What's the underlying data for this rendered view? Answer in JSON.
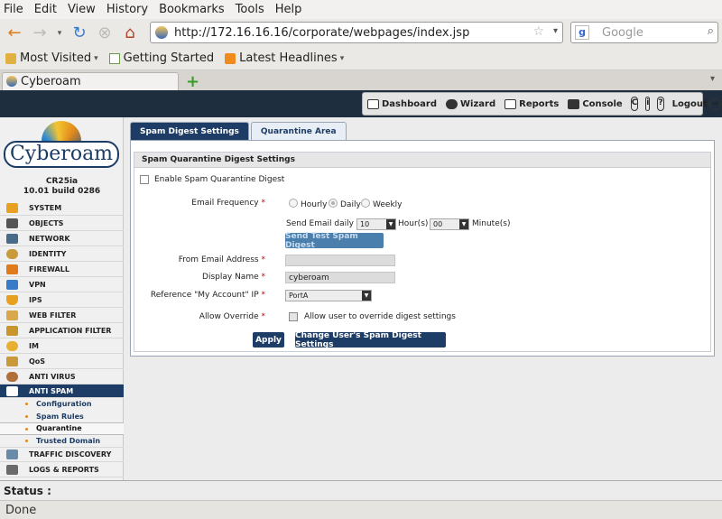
{
  "browser": {
    "menu": [
      "File",
      "Edit",
      "View",
      "History",
      "Bookmarks",
      "Tools",
      "Help"
    ],
    "url": "http://172.16.16.16/corporate/webpages/index.jsp",
    "search_placeholder": "Google",
    "bookmarks": [
      "Most Visited",
      "Getting Started",
      "Latest Headlines"
    ],
    "tab_title": "Cyberoam",
    "status_done": "Done"
  },
  "toolbar": {
    "dashboard": "Dashboard",
    "wizard": "Wizard",
    "reports": "Reports",
    "console": "Console",
    "logout": "Logout"
  },
  "brand": {
    "logo_text": "Cyberoam",
    "model": "CR25ia",
    "version": "10.01 build 0286"
  },
  "nav": {
    "items": [
      "SYSTEM",
      "OBJECTS",
      "NETWORK",
      "IDENTITY",
      "FIREWALL",
      "VPN",
      "IPS",
      "WEB FILTER",
      "APPLICATION FILTER",
      "IM",
      "QoS",
      "ANTI VIRUS"
    ],
    "active": "ANTI SPAM",
    "subitems": [
      "Configuration",
      "Spam Rules",
      "Quarantine",
      "Trusted Domain"
    ],
    "after": [
      "TRAFFIC DISCOVERY",
      "LOGS & REPORTS"
    ]
  },
  "tabs": [
    "Spam Digest Settings",
    "Quarantine Area"
  ],
  "form": {
    "section_title": "Spam Quarantine Digest Settings",
    "enable_label": "Enable Spam Quarantine Digest",
    "freq_label": "Email Frequency",
    "req": "*",
    "freq_options": [
      "Hourly",
      "Daily",
      "Weekly"
    ],
    "send_daily_label": "Send Email daily at",
    "hour_value": "10",
    "hours_label": "Hour(s)",
    "minute_value": "00",
    "minutes_label": "Minute(s)",
    "send_test_button": "Send Test Spam Digest",
    "from_label": "From Email Address",
    "from_value": "",
    "display_label": "Display Name",
    "display_value": "cyberoam",
    "ref_label": "Reference \"My Account\" IP",
    "ref_value": "PortA",
    "override_label": "Allow Override",
    "override_checkbox": "Allow user to override digest settings",
    "apply_button": "Apply",
    "change_button": "Change User's Spam Digest Settings"
  },
  "status": {
    "label": "Status :"
  },
  "colors": {
    "brand_navy": "#1e3d66",
    "header_bg": "#1e2e3e",
    "required": "#cc0000"
  }
}
